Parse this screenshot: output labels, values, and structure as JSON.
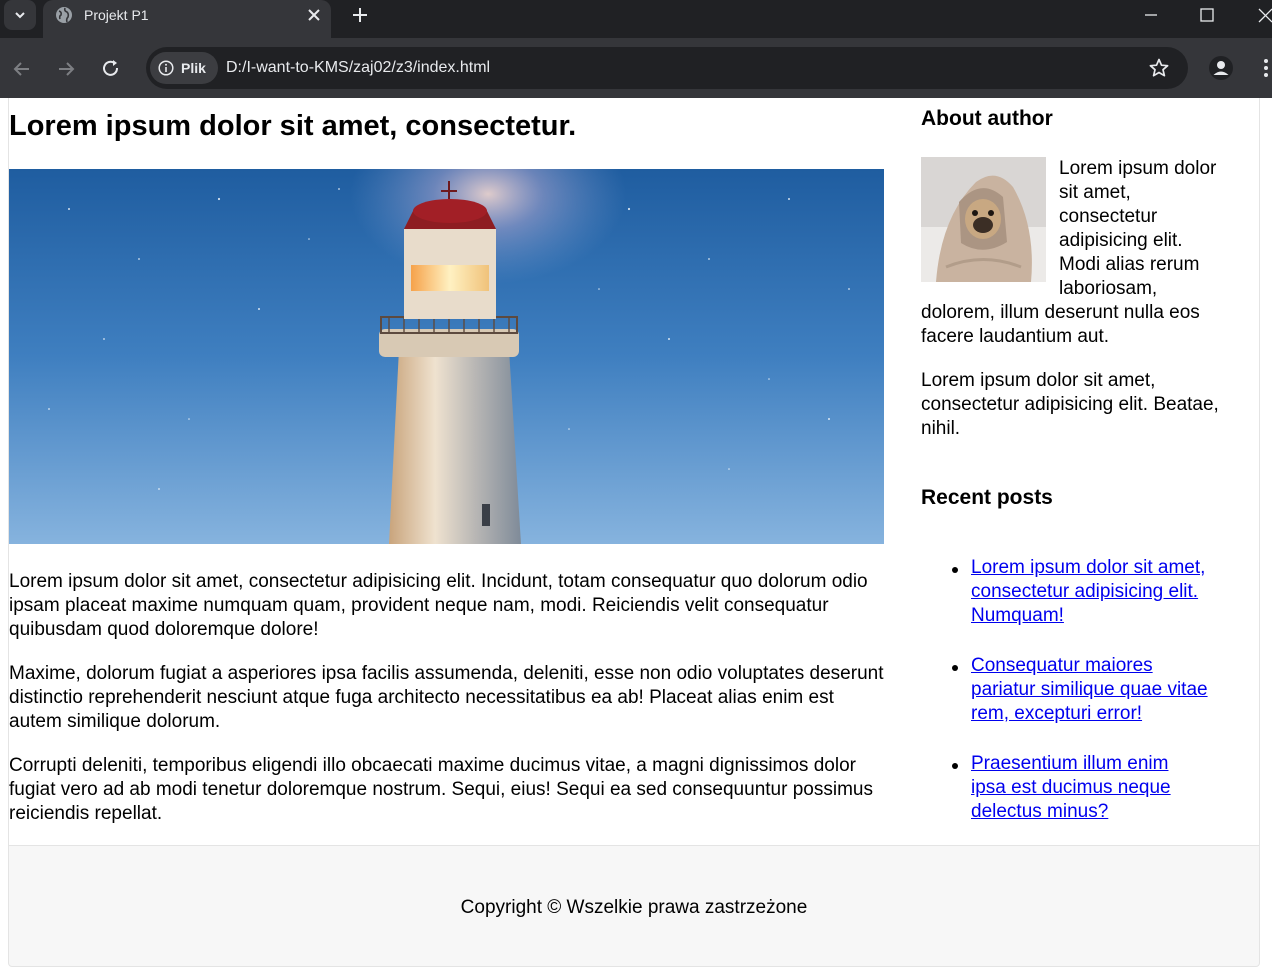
{
  "browser": {
    "tab_title": "Projekt P1",
    "site_chip_label": "Plik",
    "url": "D:/I-want-to-KMS/zaj02/z3/index.html",
    "icons": [
      "tab-search-icon",
      "globe-icon",
      "close-icon",
      "plus-icon",
      "minimize-icon",
      "maximize-icon",
      "window-close-icon",
      "back-icon",
      "forward-icon",
      "reload-icon",
      "info-icon",
      "star-icon",
      "profile-icon",
      "more-icon"
    ]
  },
  "article": {
    "title": "Lorem ipsum dolor sit amet, consectetur.",
    "paragraphs": [
      "Lorem ipsum dolor sit amet, consectetur adipisicing elit. Incidunt, totam consequatur quo dolorum odio ipsam placeat maxime numquam quam, provident neque nam, modi. Reiciendis velit consequatur quibusdam quod doloremque dolore!",
      "Maxime, dolorum fugiat a asperiores ipsa facilis assumenda, deleniti, esse non odio voluptates deserunt distinctio reprehenderit nesciunt atque fuga architecto necessitatibus ea ab! Placeat alias enim est autem similique dolorum.",
      "Corrupti deleniti, temporibus eligendi illo obcaecati maxime ducimus vitae, a magni dignissimos dolor fugiat vero ad ab modi tenetur doloremque nostrum. Sequi, eius! Sequi ea sed consequuntur possimus reiciendis repellat."
    ]
  },
  "sidebar": {
    "about_heading": "About author",
    "author_bio": "Lorem ipsum dolor sit amet, consectetur adipisicing elit. Modi alias rerum laboriosam, dolorem, illum deserunt nulla eos facere laudantium aut.",
    "author_extra": "Lorem ipsum dolor sit amet, consectetur adipisicing elit. Beatae, nihil.",
    "recent_heading": "Recent posts",
    "recent_posts": [
      "Lorem ipsum dolor sit amet, consectetur adipisicing elit. Numquam!",
      "Consequatur maiores pariatur similique quae vitae rem, excepturi error!",
      "Praesentium illum enim ipsa est ducimus neque delectus minus?"
    ]
  },
  "footer": {
    "text": "Copyright © Wszelkie prawa zastrzeżone"
  },
  "colors": {
    "link": "#0000ee",
    "chrome_dark": "#202124",
    "chrome_toolbar": "#35363a",
    "footer_bg": "#f7f7f7"
  }
}
